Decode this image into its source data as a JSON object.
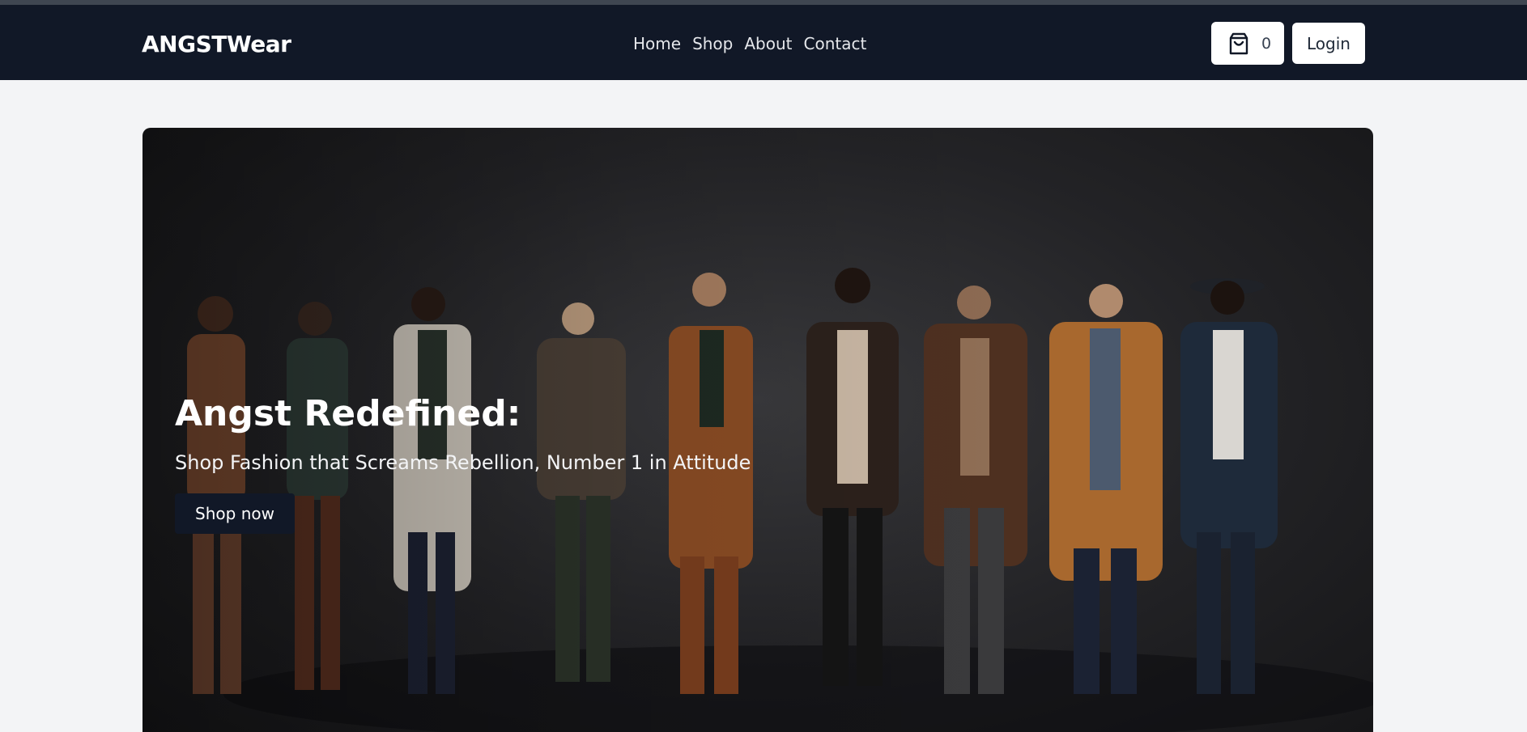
{
  "header": {
    "brand": "ANGSTWear",
    "nav": [
      {
        "label": "Home"
      },
      {
        "label": "Shop"
      },
      {
        "label": "About"
      },
      {
        "label": "Contact"
      }
    ],
    "cart": {
      "icon": "shopping-bag-icon",
      "count": "0"
    },
    "login_label": "Login"
  },
  "hero": {
    "title": "Angst Redefined:",
    "subtitle": "Shop Fashion that Screams Rebellion, Number 1 in Attitude",
    "cta_label": "Shop now"
  },
  "colors": {
    "nav_bg": "#111827",
    "page_bg": "#f3f4f6",
    "cta_bg": "#111827"
  }
}
